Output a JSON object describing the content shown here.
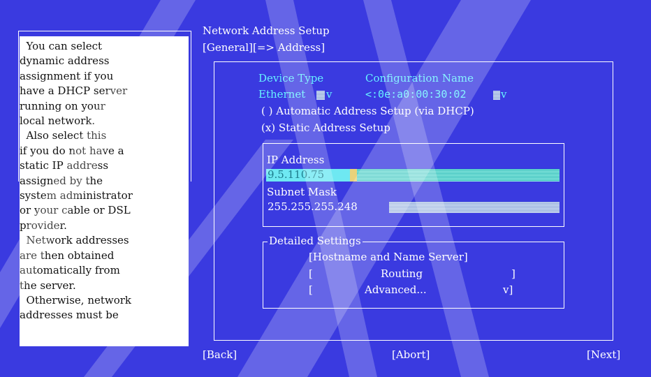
{
  "window_title": "Network Address Setup",
  "tabs": "[General][=>  Address]",
  "help_text": "  You can select\ndynamic address\nassignment if you\nhave a DHCP server\nrunning on your\nlocal network.\n  Also select this\nif you do not have a\nstatic IP address\nassigned by the\nsystem administrator\nor your cable or DSL\nprovider.\n  Network addresses\nare then obtained\nautomatically from\nthe server.\n  Otherwise, network\naddresses must be",
  "device": {
    "type_label": "Device Type",
    "config_label": "Configuration Name",
    "type_value": "Ethernet",
    "type_arrow": "v",
    "config_value": "<:0e:a0:00:30:02",
    "config_arrow": "v"
  },
  "options": {
    "dhcp": "( ) Automatic Address Setup (via DHCP)",
    "static": "(x) Static Address Setup"
  },
  "ip": {
    "label": "IP Address",
    "value": "9.5.110.75",
    "mask_label": "Subnet Mask",
    "mask_value": "255.255.255.248"
  },
  "detailed": {
    "title": "Detailed Settings",
    "hostname": "[Hostname and Name Server]",
    "routing_open": "[",
    "routing": "Routing",
    "routing_close": "]",
    "advanced_open": "[",
    "advanced": "Advanced...",
    "advanced_close": "v]"
  },
  "buttons": {
    "back": "[Back]",
    "abort": "[Abort]",
    "next": "[Next]"
  },
  "colors": {
    "background": "#3a3ae0",
    "accent_cyan": "#66f0ff",
    "text": "#ffffff"
  }
}
